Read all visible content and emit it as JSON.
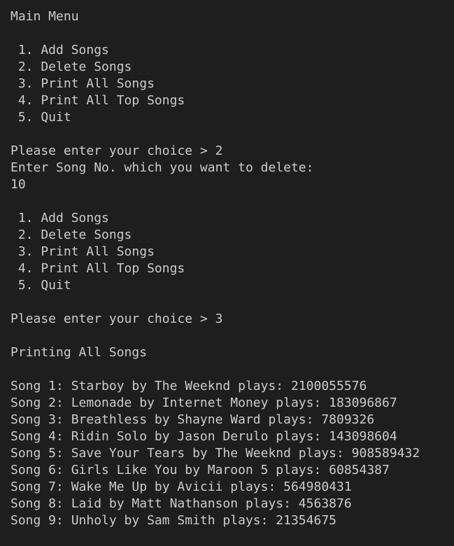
{
  "terminal": {
    "lines": [
      "Main Menu",
      "",
      " 1. Add Songs",
      " 2. Delete Songs",
      " 3. Print All Songs",
      " 4. Print All Top Songs",
      " 5. Quit",
      "",
      "Please enter your choice > 2",
      "Enter Song No. which you want to delete:",
      "10",
      "",
      " 1. Add Songs",
      " 2. Delete Songs",
      " 3. Print All Songs",
      " 4. Print All Top Songs",
      " 5. Quit",
      "",
      "Please enter your choice > 3",
      "",
      "Printing All Songs",
      "",
      "Song 1: Starboy by The Weeknd plays: 2100055576",
      "Song 2: Lemonade by Internet Money plays: 183096867",
      "Song 3: Breathless by Shayne Ward plays: 7809326",
      "Song 4: Ridin Solo by Jason Derulo plays: 143098604",
      "Song 5: Save Your Tears by The Weeknd plays: 908589432",
      "Song 6: Girls Like You by Maroon 5 plays: 60854387",
      "Song 7: Wake Me Up by Avicii plays: 564980431",
      "Song 8: Laid by Matt Nathanson plays: 4563876",
      "Song 9: Unholy by Sam Smith plays: 21354675"
    ]
  }
}
